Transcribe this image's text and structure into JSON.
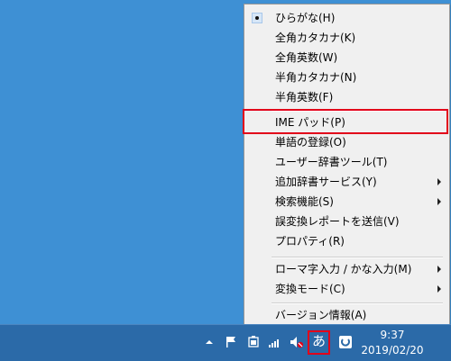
{
  "menu": {
    "items": [
      {
        "label": "ひらがな(H)",
        "checked": true,
        "submenu": false
      },
      {
        "label": "全角カタカナ(K)",
        "checked": false,
        "submenu": false
      },
      {
        "label": "全角英数(W)",
        "checked": false,
        "submenu": false
      },
      {
        "label": "半角カタカナ(N)",
        "checked": false,
        "submenu": false
      },
      {
        "label": "半角英数(F)",
        "checked": false,
        "submenu": false
      },
      {
        "label": "IME パッド(P)",
        "checked": false,
        "submenu": false,
        "highlighted": true
      },
      {
        "label": "単語の登録(O)",
        "checked": false,
        "submenu": false
      },
      {
        "label": "ユーザー辞書ツール(T)",
        "checked": false,
        "submenu": false
      },
      {
        "label": "追加辞書サービス(Y)",
        "checked": false,
        "submenu": true
      },
      {
        "label": "検索機能(S)",
        "checked": false,
        "submenu": true
      },
      {
        "label": "誤変換レポートを送信(V)",
        "checked": false,
        "submenu": false
      },
      {
        "label": "プロパティ(R)",
        "checked": false,
        "submenu": false
      },
      {
        "label": "ローマ字入力 / かな入力(M)",
        "checked": false,
        "submenu": true
      },
      {
        "label": "変換モード(C)",
        "checked": false,
        "submenu": true
      },
      {
        "label": "バージョン情報(A)",
        "checked": false,
        "submenu": false
      }
    ]
  },
  "taskbar": {
    "ime_mode_glyph": "あ",
    "tray_icons": [
      "chevron-up-icon",
      "flag-icon",
      "battery-icon",
      "signal-icon",
      "speaker-muted-icon",
      "ime-icon",
      "ime-toggle-icon"
    ],
    "clock": {
      "time": "9:37",
      "date": "2019/02/20"
    }
  },
  "colors": {
    "highlight": "#e2001a",
    "desktop": "#3e90d4",
    "taskbar": "#2b6aa8"
  }
}
